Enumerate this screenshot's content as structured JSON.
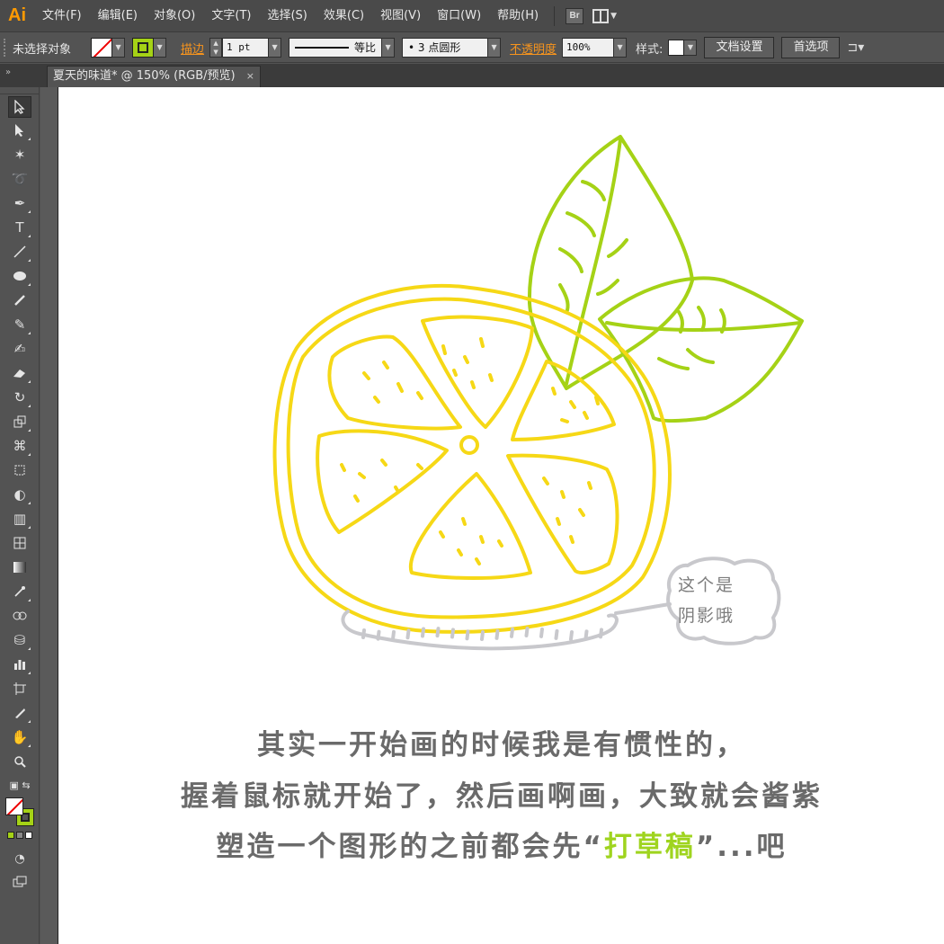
{
  "app": {
    "logo": "Ai"
  },
  "menu": {
    "items": [
      "文件(F)",
      "编辑(E)",
      "对象(O)",
      "文字(T)",
      "选择(S)",
      "效果(C)",
      "视图(V)",
      "窗口(W)",
      "帮助(H)"
    ],
    "bridge_label": "Br"
  },
  "control_bar": {
    "selection_status": "未选择对象",
    "stroke_link": "描边",
    "stroke_weight": "1 pt",
    "stroke_profile": "等比",
    "brush": "• 3 点圆形",
    "opacity_link": "不透明度",
    "opacity_value": "100%",
    "style_label": "样式:",
    "doc_setup_button": "文档设置",
    "preferences_button": "首选项",
    "fill_color": "none",
    "stroke_color": "#a5d216"
  },
  "document_tab": {
    "title": "夏天的味道* @ 150% (RGB/预览)",
    "close_glyph": "×"
  },
  "artwork": {
    "bubble_line1": "这个是",
    "bubble_line2": "阴影哦",
    "caption_line1": "其实一开始画的时候我是有惯性的，",
    "caption_line2": "握着鼠标就开始了，然后画啊画，大致就会酱紫",
    "caption_line3_pre": "塑造一个图形的之前都会先“",
    "caption_line3_highlight": "打草稿",
    "caption_line3_post": "”...吧",
    "colors": {
      "lemon": "#f6d816",
      "leaf": "#a5d216",
      "shadow": "#c8c8cc",
      "caption": "#6a6a6a",
      "highlight": "#9fd41f"
    }
  }
}
